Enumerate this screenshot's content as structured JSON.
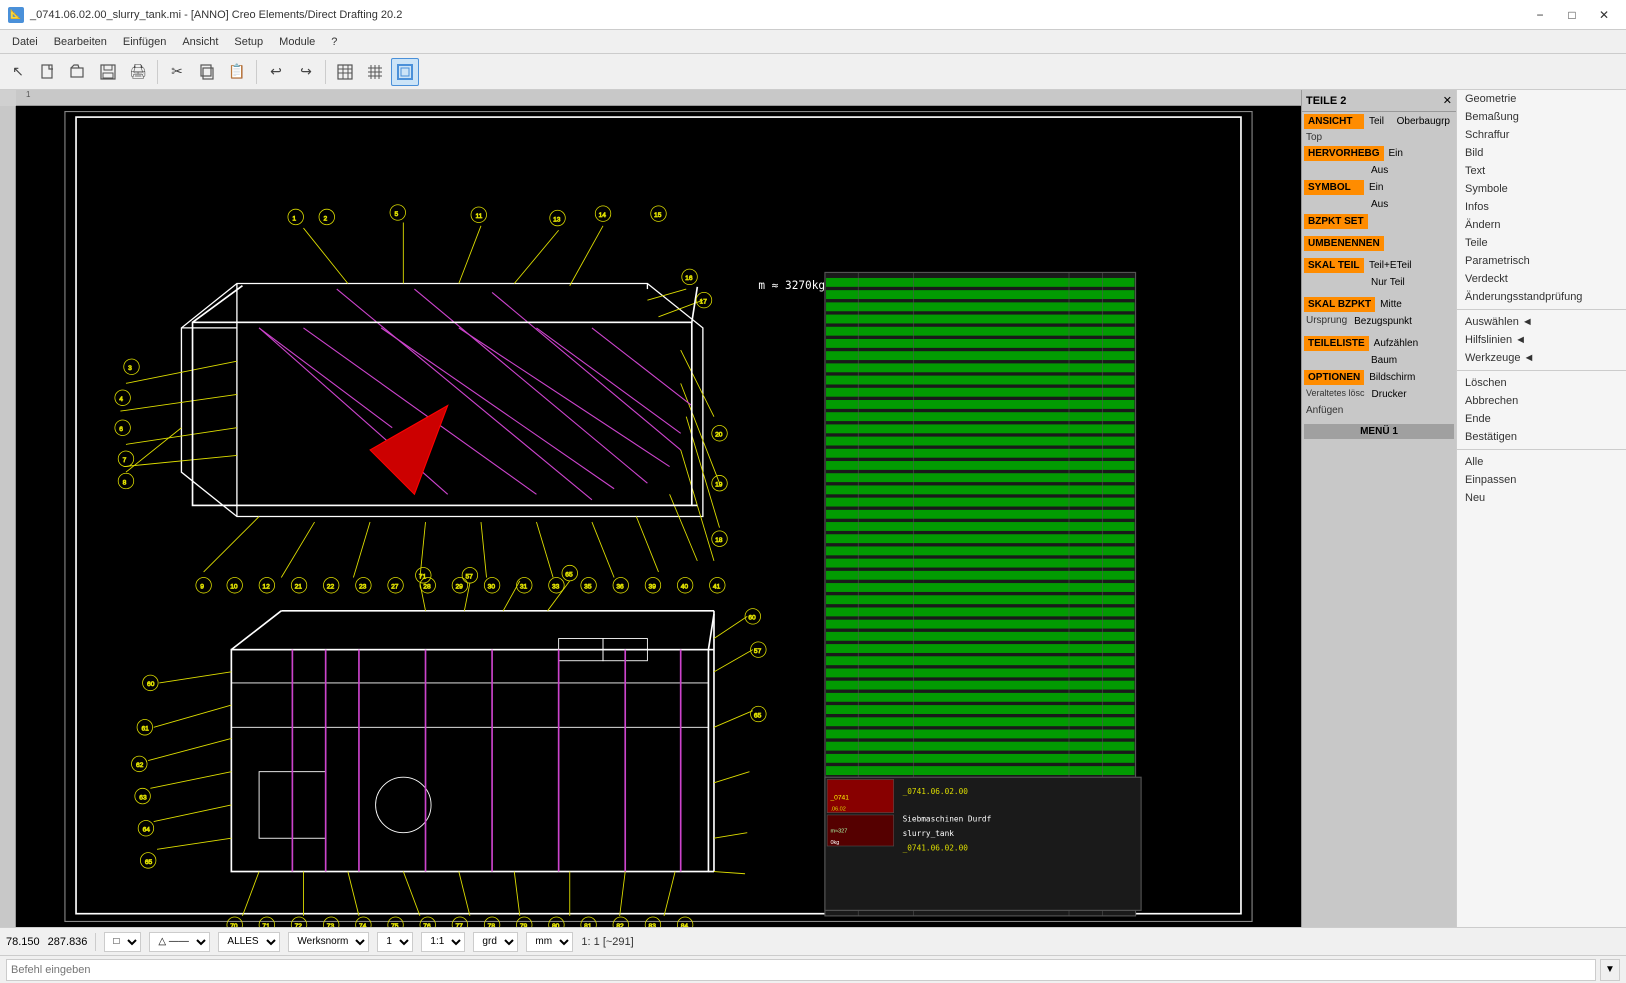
{
  "titlebar": {
    "icon": "📐",
    "title": "_0741.06.02.00_slurry_tank.mi - [ANNO]  Creo Elements/Direct Drafting 20.2",
    "minimize": "−",
    "maximize": "□",
    "close": "✕"
  },
  "menubar": {
    "items": [
      "Datei",
      "Bearbeiten",
      "Einfügen",
      "Ansicht",
      "Setup",
      "Module",
      "?"
    ]
  },
  "toolbar": {
    "buttons": [
      {
        "name": "cursor",
        "icon": "↖",
        "label": "Cursor"
      },
      {
        "name": "new",
        "icon": "📄",
        "label": "New"
      },
      {
        "name": "open",
        "icon": "📂",
        "label": "Open"
      },
      {
        "name": "save",
        "icon": "💾",
        "label": "Save"
      },
      {
        "name": "print",
        "icon": "🖨",
        "label": "Print"
      },
      {
        "sep": true
      },
      {
        "name": "cut",
        "icon": "✂",
        "label": "Cut"
      },
      {
        "name": "copy",
        "icon": "⧉",
        "label": "Copy"
      },
      {
        "name": "paste",
        "icon": "📋",
        "label": "Paste"
      },
      {
        "sep": true
      },
      {
        "name": "undo",
        "icon": "↩",
        "label": "Undo"
      },
      {
        "name": "redo",
        "icon": "↪",
        "label": "Redo"
      },
      {
        "sep": true
      },
      {
        "name": "table",
        "icon": "▦",
        "label": "Table"
      },
      {
        "name": "grid",
        "icon": "⊞",
        "label": "Grid"
      },
      {
        "name": "frame",
        "icon": "▣",
        "label": "Frame",
        "active": true
      }
    ]
  },
  "teile2": {
    "title": "TEILE 2",
    "close_icon": "✕",
    "sections": [
      {
        "type": "row",
        "items": [
          {
            "type": "orange",
            "label": "ANSICHT"
          },
          {
            "type": "gray",
            "label": "Teil"
          },
          {
            "type": "gray",
            "label": "Oberbaugrp"
          }
        ]
      },
      {
        "type": "row",
        "items": [
          {
            "type": "empty",
            "label": "Top"
          },
          {
            "type": "empty",
            "label": ""
          }
        ]
      },
      {
        "type": "row",
        "items": [
          {
            "type": "orange",
            "label": "HERVORHEBG"
          },
          {
            "type": "gray",
            "label": "Ein"
          },
          {
            "type": "empty",
            "label": ""
          }
        ]
      },
      {
        "type": "row",
        "items": [
          {
            "type": "empty",
            "label": ""
          },
          {
            "type": "gray",
            "label": "Aus"
          },
          {
            "type": "empty",
            "label": ""
          }
        ]
      },
      {
        "type": "row",
        "items": [
          {
            "type": "orange",
            "label": "SYMBOL"
          },
          {
            "type": "gray",
            "label": "Ein"
          },
          {
            "type": "empty",
            "label": ""
          }
        ]
      },
      {
        "type": "row",
        "items": [
          {
            "type": "empty",
            "label": ""
          },
          {
            "type": "gray",
            "label": "Aus"
          },
          {
            "type": "empty",
            "label": ""
          }
        ]
      },
      {
        "type": "row",
        "items": [
          {
            "type": "orange",
            "label": "BZPKT SET"
          }
        ]
      },
      {
        "type": "spacer"
      },
      {
        "type": "row",
        "items": [
          {
            "type": "orange",
            "label": "UMBENENNEN"
          }
        ]
      },
      {
        "type": "spacer"
      },
      {
        "type": "row",
        "items": [
          {
            "type": "orange",
            "label": "SKAL TEIL"
          },
          {
            "type": "gray",
            "label": "Teil+ETeil"
          },
          {
            "type": "empty",
            "label": ""
          }
        ]
      },
      {
        "type": "row",
        "items": [
          {
            "type": "empty",
            "label": ""
          },
          {
            "type": "gray",
            "label": "Nur Teil"
          },
          {
            "type": "empty",
            "label": ""
          }
        ]
      },
      {
        "type": "spacer"
      },
      {
        "type": "row",
        "items": [
          {
            "type": "orange",
            "label": "SKAL BZPKT"
          },
          {
            "type": "gray",
            "label": "Mitte"
          },
          {
            "type": "empty",
            "label": ""
          }
        ]
      },
      {
        "type": "row",
        "items": [
          {
            "type": "empty",
            "label": "Ursprung"
          },
          {
            "type": "gray",
            "label": "Bezugspunkt"
          },
          {
            "type": "empty",
            "label": ""
          }
        ]
      },
      {
        "type": "spacer"
      },
      {
        "type": "row",
        "items": [
          {
            "type": "orange",
            "label": "TEILELISTE"
          },
          {
            "type": "gray",
            "label": "Aufzählen"
          },
          {
            "type": "empty",
            "label": ""
          }
        ]
      },
      {
        "type": "row",
        "items": [
          {
            "type": "empty",
            "label": ""
          },
          {
            "type": "gray",
            "label": "Baum"
          },
          {
            "type": "empty",
            "label": ""
          }
        ]
      },
      {
        "type": "row",
        "items": [
          {
            "type": "orange",
            "label": "OPTIONEN"
          },
          {
            "type": "gray",
            "label": "Bildschirm"
          },
          {
            "type": "empty",
            "label": ""
          }
        ]
      },
      {
        "type": "row",
        "items": [
          {
            "type": "empty",
            "label": "Veraltetes lösc"
          },
          {
            "type": "gray",
            "label": "Drucker"
          },
          {
            "type": "empty",
            "label": ""
          }
        ]
      },
      {
        "type": "row",
        "items": [
          {
            "type": "empty",
            "label": "Anfügen"
          }
        ]
      },
      {
        "type": "spacer"
      },
      {
        "type": "row",
        "items": [
          {
            "type": "gray-dark",
            "label": "MENÜ 1"
          }
        ]
      }
    ]
  },
  "far_right_menu": {
    "sections": [
      {
        "items": [
          "Geometrie",
          "Bemaßung",
          "Schraffur",
          "Bild",
          "Text",
          "Symbole",
          "Infos",
          "Ändern",
          "Teile",
          "Parametrisch",
          "Verdeckt",
          "Änderungsstandprüfung"
        ]
      },
      {
        "items": [
          "Auswählen ◄",
          "Hilfslinien ◄",
          "Werkzeuge ◄"
        ]
      },
      {
        "items": [
          "Löschen",
          "Abbrechen",
          "Ende",
          "Bestätigen"
        ]
      },
      {
        "items": [
          "Alle",
          "Einpassen",
          "Neu"
        ]
      }
    ]
  },
  "statusbar": {
    "x": "78.150",
    "y": "287.836",
    "shape_dropdown": "□",
    "line_dropdown": "△ ——",
    "layer": "ALLES",
    "norm": "Werksnorm",
    "num1": "1",
    "scale": "1:1",
    "coord": "grd",
    "unit": "mm",
    "view": "1: 1 [~291]"
  },
  "commandbar": {
    "placeholder": "Befehl eingeben"
  },
  "canvas": {
    "weight_label": "m = 3270kg",
    "coord_display": "_0741.06.02.00",
    "thumbnail_label": "Siebmaschinen Durdf slurry_tank",
    "thumbnail_coord": "_0741.06.02.00"
  }
}
